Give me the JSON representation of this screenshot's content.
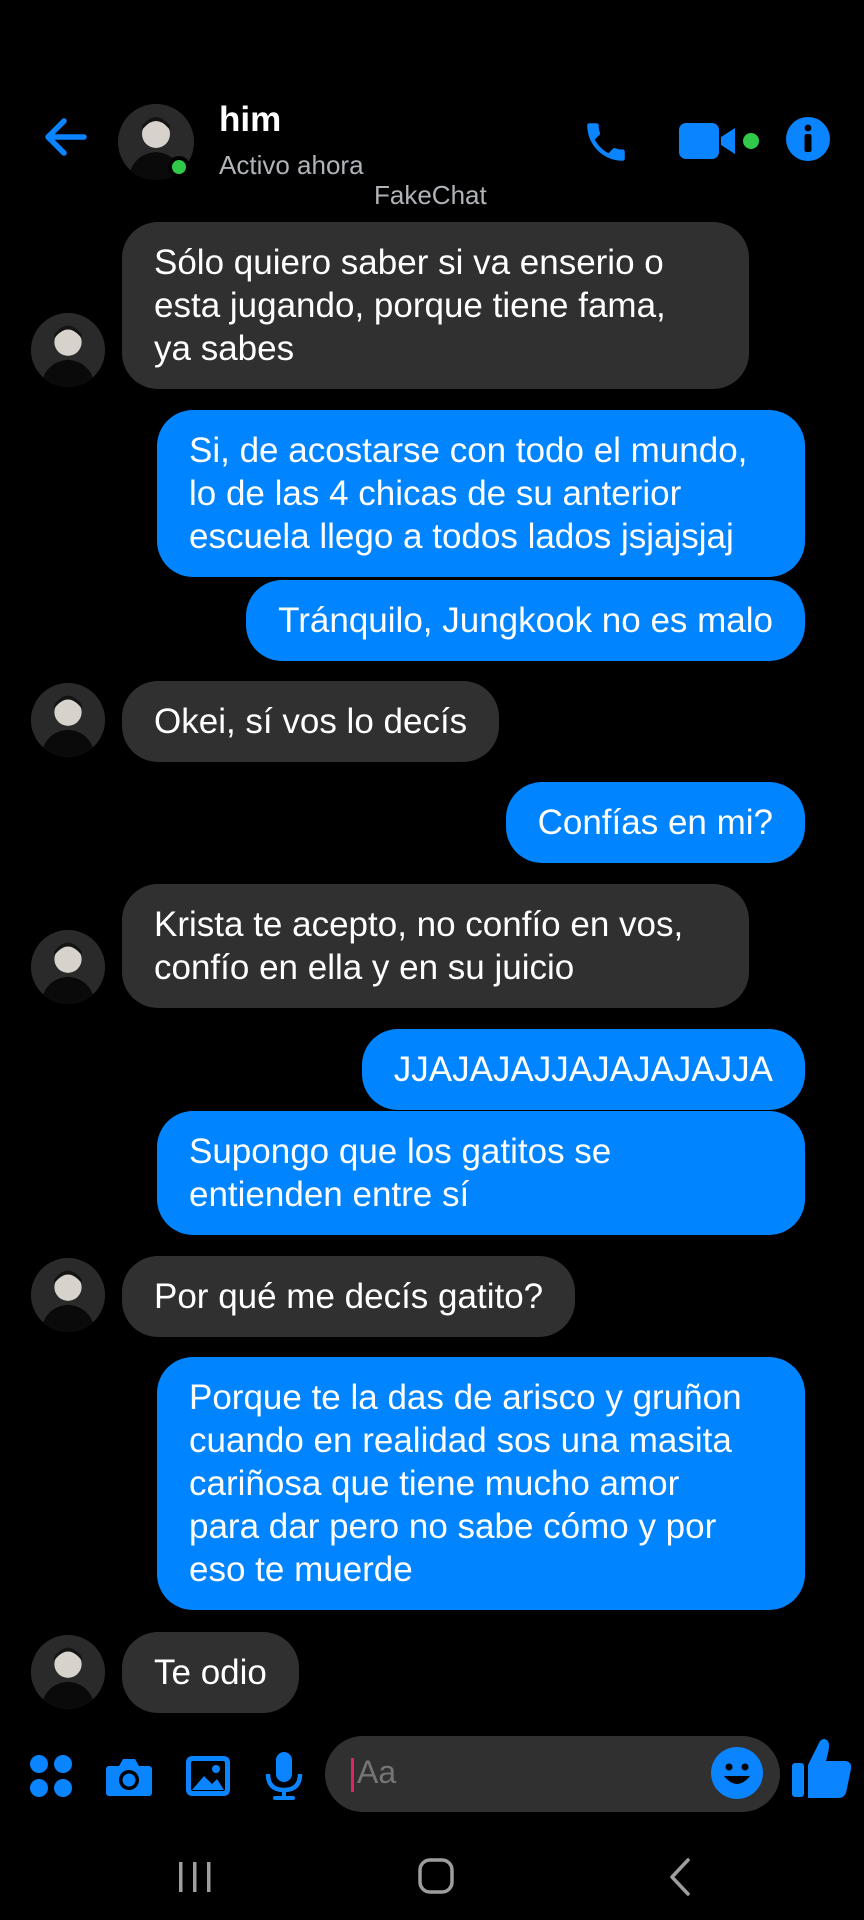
{
  "header": {
    "contact_name": "him",
    "status": "Activo ahora",
    "watermark": "FakeChat",
    "icons": [
      "back-arrow-icon",
      "phone-icon",
      "video-camera-icon",
      "info-icon"
    ]
  },
  "messages": [
    {
      "side": "left",
      "text": "Sólo quiero saber si va enserio o\nesta jugando, porque tiene fama,\nya sabes"
    },
    {
      "side": "right",
      "text": "Si, de acostarse con todo el mundo,\nlo de las 4 chicas de su anterior\nescuela llego a todos lados jsjajsjaj"
    },
    {
      "side": "right",
      "text": "Tránquilo, Jungkook no es malo"
    },
    {
      "side": "left",
      "text": "Okei, sí vos lo decís"
    },
    {
      "side": "right",
      "text": "Confías en mi?"
    },
    {
      "side": "left",
      "text": "Krista te acepto, no confío en vos,\nconfío en ella y en su juicio"
    },
    {
      "side": "right",
      "text": "JJAJAJAJJAJAJAJAJJA"
    },
    {
      "side": "right",
      "text": "Supongo que los gatitos se\nentienden entre sí"
    },
    {
      "side": "left",
      "text": "Por qué me decís gatito?"
    },
    {
      "side": "right",
      "text": "Porque te la das de arisco y gruñon\ncuando en realidad sos una masita\ncariñosa que tiene mucho amor\npara dar pero no sabe cómo y por\neso te muerde"
    },
    {
      "side": "left",
      "text": "Te odio"
    }
  ],
  "composer": {
    "placeholder": "Aa",
    "icons": [
      "apps-icon",
      "camera-icon",
      "gallery-icon",
      "microphone-icon",
      "emoji-icon",
      "thumbs-up-icon"
    ]
  },
  "colors": {
    "accent": "#0084ff",
    "incoming_bubble": "#303030",
    "online": "#31c94a",
    "background": "#000000"
  }
}
